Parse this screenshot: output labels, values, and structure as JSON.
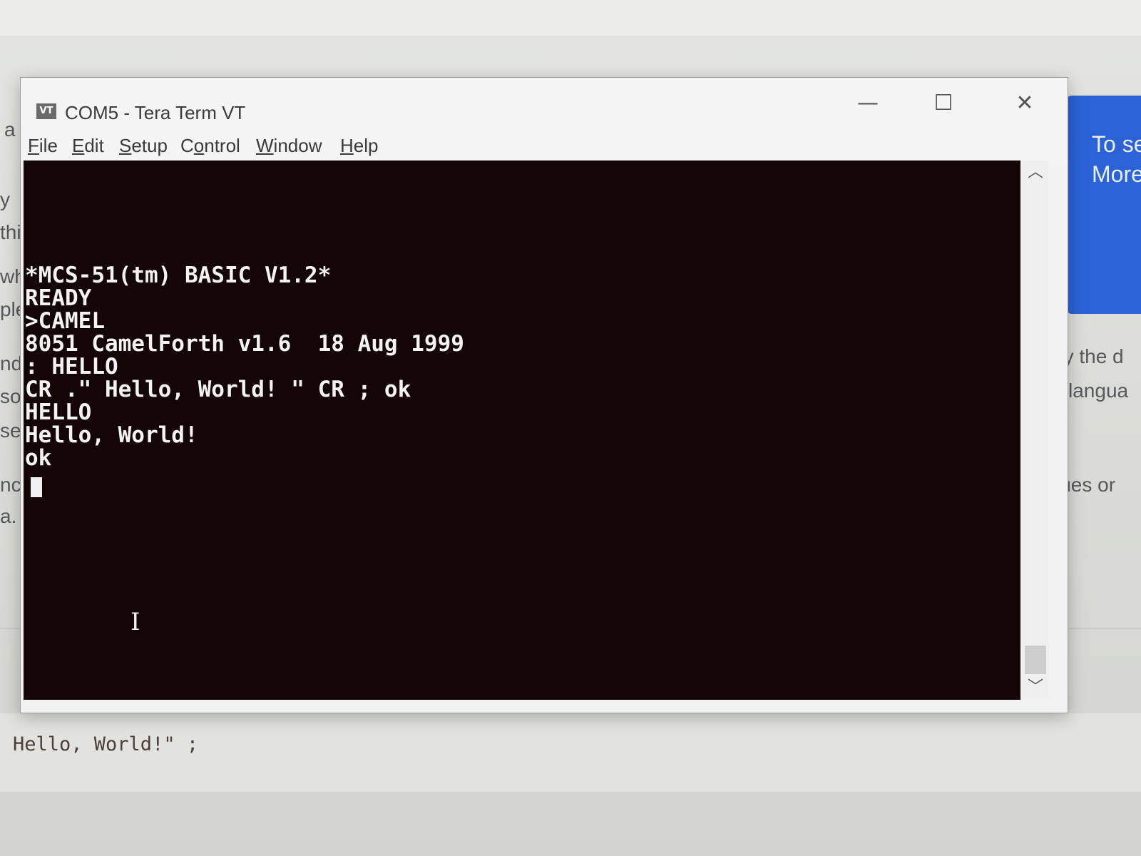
{
  "background_page": {
    "left_fragments": [
      "a",
      "y",
      "this",
      "wh",
      "ple",
      "nd",
      "so",
      "se",
      "nc",
      "a."
    ],
    "right_fragments": [
      "by the d",
      "langua",
      "lues or"
    ],
    "blue_card": {
      "line1": "To se",
      "line2": "More",
      "color": "#2b62d6"
    },
    "code_snippet": "Hello, World!\" ;"
  },
  "window": {
    "title": "COM5 - Tera Term VT",
    "icon_label": "VT",
    "controls": {
      "minimize": "—",
      "maximize": "☐",
      "close": "✕"
    },
    "menu": [
      {
        "mnemonic": "F",
        "rest": "ile"
      },
      {
        "mnemonic": "E",
        "rest": "dit"
      },
      {
        "mnemonic": "S",
        "rest": "etup"
      },
      {
        "mnemonic": "C",
        "rest": "ontrol",
        "prefix": "C"
      },
      {
        "mnemonic": "W",
        "rest": "indow"
      },
      {
        "mnemonic": "H",
        "rest": "elp"
      }
    ]
  },
  "terminal": {
    "background_color": "#140606",
    "text_color": "#f3f3f3",
    "lines": [
      "*MCS-51(tm) BASIC V1.2*",
      "READY",
      ">CAMEL",
      "8051 CamelForth v1.6  18 Aug 1999",
      ": HELLO",
      "CR .\" Hello, World! \" CR ; ok",
      "HELLO",
      "Hello, World!",
      "ok"
    ]
  },
  "scrollbar": {
    "up_icon": "︿",
    "down_icon": "﹀"
  }
}
